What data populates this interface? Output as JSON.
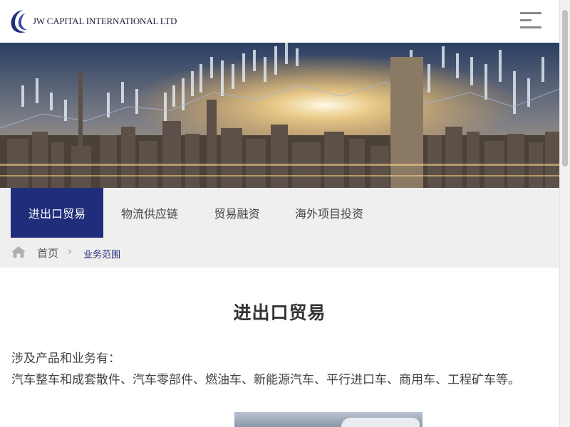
{
  "header": {
    "logo_text": "JW CAPITAL INTERNATIONAL LTD",
    "logo_icon": "crescent-logo-icon",
    "menu_icon": "hamburger-menu-icon"
  },
  "tabs": [
    {
      "label": "进出口贸易",
      "active": true
    },
    {
      "label": "物流供应链",
      "active": false
    },
    {
      "label": "贸易融资",
      "active": false
    },
    {
      "label": "海外项目投资",
      "active": false
    }
  ],
  "breadcrumb": {
    "home_icon": "home-icon",
    "home": "首页",
    "separator": "›",
    "current": "业务范围"
  },
  "content": {
    "title": "进出口贸易",
    "paragraph_1": "涉及产品和业务有：",
    "paragraph_2": "汽车整车和成套散件、汽车零部件、燃油车、新能源汽车、平行进口车、商用车、工程矿车等。"
  },
  "colors": {
    "accent": "#1f2d7a",
    "tab_bar_bg": "#efefef",
    "text": "#444444"
  }
}
